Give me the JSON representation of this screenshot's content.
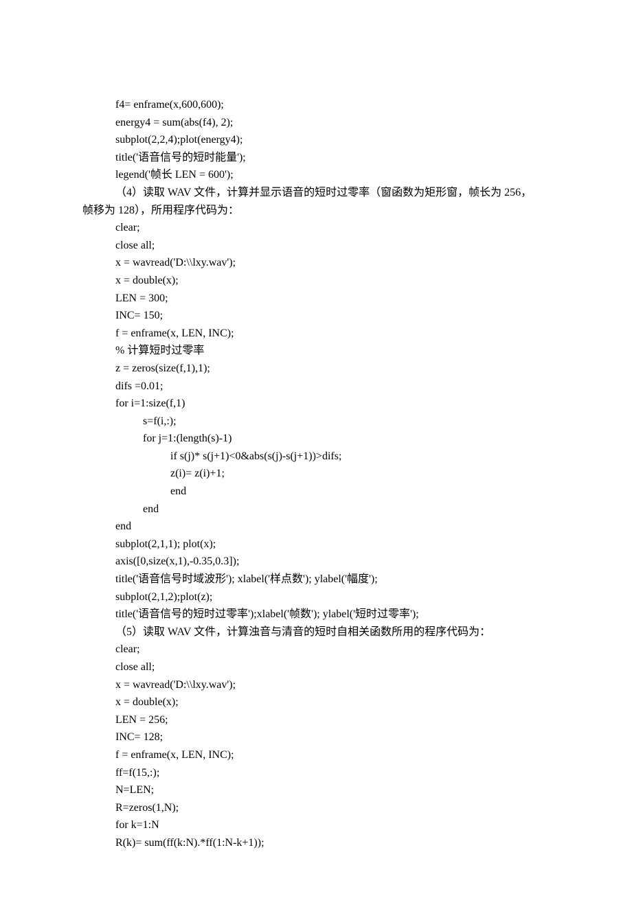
{
  "lines": [
    {
      "cls": "code-line-indent1",
      "text": "f4= enframe(x,600,600);"
    },
    {
      "cls": "code-line-indent1",
      "text": "energy4 = sum(abs(f4), 2);"
    },
    {
      "cls": "code-line-indent1",
      "text": "subplot(2,2,4);plot(energy4);"
    },
    {
      "cls": "code-line-indent1",
      "text": "title('语音信号的短时能量');"
    },
    {
      "cls": "code-line-indent1",
      "text": "legend('帧长 LEN = 600');"
    },
    {
      "cls": "paragraph-indent",
      "text": "（4）读取 WAV 文件，计算并显示语音的短时过零率（窗函数为矩形窗，帧长为 256，"
    },
    {
      "cls": "continuation",
      "text": "帧移为 128），所用程序代码为："
    },
    {
      "cls": "code-line-indent1",
      "text": "clear;"
    },
    {
      "cls": "code-line-indent1",
      "text": "close all;"
    },
    {
      "cls": "code-line-indent1",
      "text": "x = wavread('D:\\\\lxy.wav');"
    },
    {
      "cls": "code-line-indent1",
      "text": "x = double(x);"
    },
    {
      "cls": "code-line-indent1",
      "text": "LEN = 300;"
    },
    {
      "cls": "code-line-indent1",
      "text": "INC= 150;"
    },
    {
      "cls": "code-line-indent1",
      "text": "f = enframe(x, LEN, INC);"
    },
    {
      "cls": "code-line-indent1",
      "text": "%  计算短时过零率"
    },
    {
      "cls": "code-line-indent1",
      "text": "z = zeros(size(f,1),1);"
    },
    {
      "cls": "code-line-indent1",
      "text": "difs =0.01;"
    },
    {
      "cls": "code-line-indent1",
      "text": "for i=1:size(f,1)"
    },
    {
      "cls": "code-line-indent2",
      "text": "s=f(i,:);"
    },
    {
      "cls": "code-line-indent2",
      "text": "for j=1:(length(s)-1)"
    },
    {
      "cls": "code-line-indent3",
      "text": "if s(j)* s(j+1)<0&abs(s(j)-s(j+1))>difs;"
    },
    {
      "cls": "code-line-indent3",
      "text": "z(i)= z(i)+1;"
    },
    {
      "cls": "code-line-indent3",
      "text": "end"
    },
    {
      "cls": "code-line-indent2",
      "text": "end"
    },
    {
      "cls": "code-line-indent1",
      "text": "end"
    },
    {
      "cls": "code-line-indent1",
      "text": "subplot(2,1,1); plot(x);"
    },
    {
      "cls": "code-line-indent1",
      "text": "axis([0,size(x,1),-0.35,0.3]);"
    },
    {
      "cls": "code-line-indent1",
      "text": "title('语音信号时域波形'); xlabel('样点数'); ylabel('幅度');"
    },
    {
      "cls": "code-line-indent1",
      "text": "subplot(2,1,2);plot(z);"
    },
    {
      "cls": "code-line-indent1",
      "text": "title('语音信号的短时过零率');xlabel('帧数'); ylabel('短时过零率');"
    },
    {
      "cls": "paragraph-indent",
      "text": "（5）读取 WAV 文件，计算浊音与清音的短时自相关函数所用的程序代码为："
    },
    {
      "cls": "code-line-indent1",
      "text": "clear;"
    },
    {
      "cls": "code-line-indent1",
      "text": "close all;"
    },
    {
      "cls": "code-line-indent1",
      "text": "x = wavread('D:\\\\lxy.wav');"
    },
    {
      "cls": "code-line-indent1",
      "text": "x = double(x);"
    },
    {
      "cls": "code-line-indent1",
      "text": "LEN = 256;"
    },
    {
      "cls": "code-line-indent1",
      "text": "INC= 128;"
    },
    {
      "cls": "code-line-indent1",
      "text": "f = enframe(x, LEN, INC);"
    },
    {
      "cls": "code-line-indent1",
      "text": "ff=f(15,:);"
    },
    {
      "cls": "code-line-indent1",
      "text": "N=LEN;"
    },
    {
      "cls": "code-line-indent1",
      "text": "R=zeros(1,N);"
    },
    {
      "cls": "code-line-indent1",
      "text": "for k=1:N"
    },
    {
      "cls": "code-line-indent1",
      "text": "R(k)= sum(ff(k:N).*ff(1:N-k+1));"
    }
  ]
}
